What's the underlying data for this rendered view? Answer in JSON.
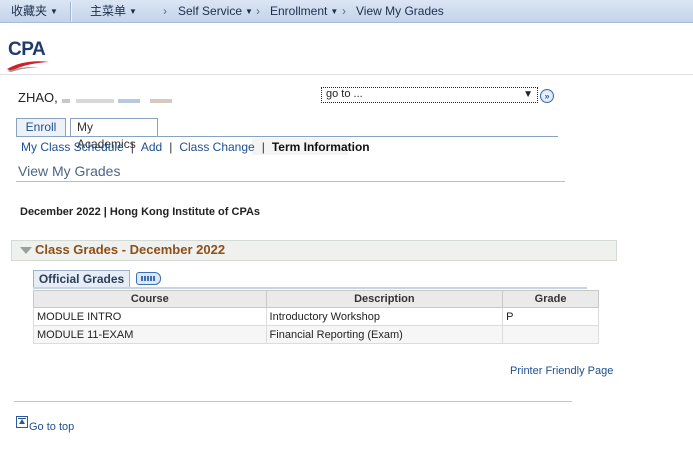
{
  "topnav": {
    "favorites": "收藏夹",
    "main_menu": "主菜单",
    "breadcrumbs": [
      "Self Service",
      "Enrollment",
      "View My Grades"
    ]
  },
  "header": {
    "logo_text": "CPA"
  },
  "person": {
    "name": "ZHAO, "
  },
  "goto": {
    "value": "go to ...",
    "button_icon": "double-chevron-right-icon"
  },
  "tabs": [
    {
      "label": "Enroll"
    },
    {
      "label": "My Academics"
    }
  ],
  "submenu": {
    "items": [
      "My Class Schedule",
      "Add",
      "Class Change"
    ],
    "current": "Term Information"
  },
  "page_title": "View My Grades",
  "term": "December 2022 | Hong Kong Institute of CPAs",
  "section": {
    "title": "Class Grades - December 2022",
    "grid_tab": "Official Grades",
    "columns": [
      "Course",
      "Description",
      "Grade"
    ],
    "rows": [
      {
        "course": "MODULE INTRO",
        "description": "Introductory Workshop",
        "grade": "P"
      },
      {
        "course": "MODULE 11-EXAM",
        "description": "Financial Reporting (Exam)",
        "grade": ""
      }
    ]
  },
  "printer_link": "Printer Friendly Page",
  "goto_top": "Go to top",
  "colors": {
    "link": "#1d4f91",
    "section_title": "#8d4f1a",
    "nav_bg": "#c3d3ea"
  }
}
